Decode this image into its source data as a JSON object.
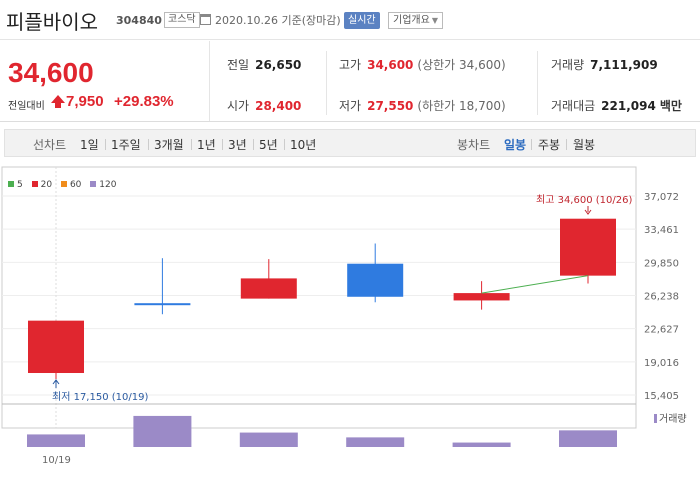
{
  "header": {
    "name": "피플바이오",
    "code": "304840",
    "market": "코스닥",
    "date": "2020.10.26 기준(장마감)",
    "realtime_button": "실시간",
    "company_info_button": "기업개요"
  },
  "price": {
    "current": "34,600",
    "change_label": "전일대비",
    "change_value": "7,950",
    "change_pct": "+29.83%"
  },
  "stats": {
    "prev_close_label": "전일",
    "prev_close": "26,650",
    "high_label": "고가",
    "high": "34,600",
    "high_sub": "(상한가 34,600)",
    "volume_label": "거래량",
    "volume": "7,111,909",
    "open_label": "시가",
    "open": "28,400",
    "low_label": "저가",
    "low": "27,550",
    "low_sub": "(하한가 18,700)",
    "amount_label": "거래대금",
    "amount": "221,094",
    "amount_unit": "백만"
  },
  "toolbar": {
    "line_chart_label": "선차트",
    "periods": [
      "1일",
      "1주일",
      "3개월",
      "1년",
      "3년",
      "5년",
      "10년"
    ],
    "candle_chart_label": "봉차트",
    "candle_periods": [
      "일봉",
      "주봉",
      "월봉"
    ],
    "active_candle": "일봉"
  },
  "legend": [
    {
      "label": "5",
      "color": "#4caf50"
    },
    {
      "label": "20",
      "color": "#e0262f"
    },
    {
      "label": "60",
      "color": "#f08c1c"
    },
    {
      "label": "120",
      "color": "#9b8ac7"
    }
  ],
  "volume_label": "거래량",
  "colors": {
    "up": "#e0262f",
    "down": "#2f7be0",
    "volume": "#9b8ac7",
    "ma5": "#4caf50"
  },
  "chart_data": {
    "type": "candlestick",
    "y_ticks": [
      "37,072",
      "33,461",
      "29,850",
      "26,238",
      "22,627",
      "19,016",
      "15,405"
    ],
    "y_tick_values": [
      37072,
      33461,
      29850,
      26238,
      22627,
      19016,
      15405
    ],
    "ylim": [
      15405,
      37072
    ],
    "x_label": "10/19",
    "candles": [
      {
        "open": 17800,
        "close": 23500,
        "high": 23500,
        "low": 17150,
        "dir": "up"
      },
      {
        "open": 25400,
        "close": 25200,
        "high": 30300,
        "low": 24200,
        "dir": "down"
      },
      {
        "open": 25900,
        "close": 28100,
        "high": 30200,
        "low": 25900,
        "dir": "up"
      },
      {
        "open": 29700,
        "close": 26100,
        "high": 31900,
        "low": 25500,
        "dir": "down"
      },
      {
        "open": 25700,
        "close": 26500,
        "high": 27800,
        "low": 24700,
        "dir": "up"
      },
      {
        "open": 28400,
        "close": 34600,
        "high": 34600,
        "low": 27550,
        "dir": "up"
      }
    ],
    "ma5": [
      null,
      null,
      null,
      null,
      26500,
      28400
    ],
    "volumes": [
      0.34,
      0.84,
      0.39,
      0.26,
      0.12,
      0.45
    ],
    "annotations": {
      "high": "최고 34,600 (10/26)",
      "low": "최저 17,150 (10/19)"
    }
  }
}
